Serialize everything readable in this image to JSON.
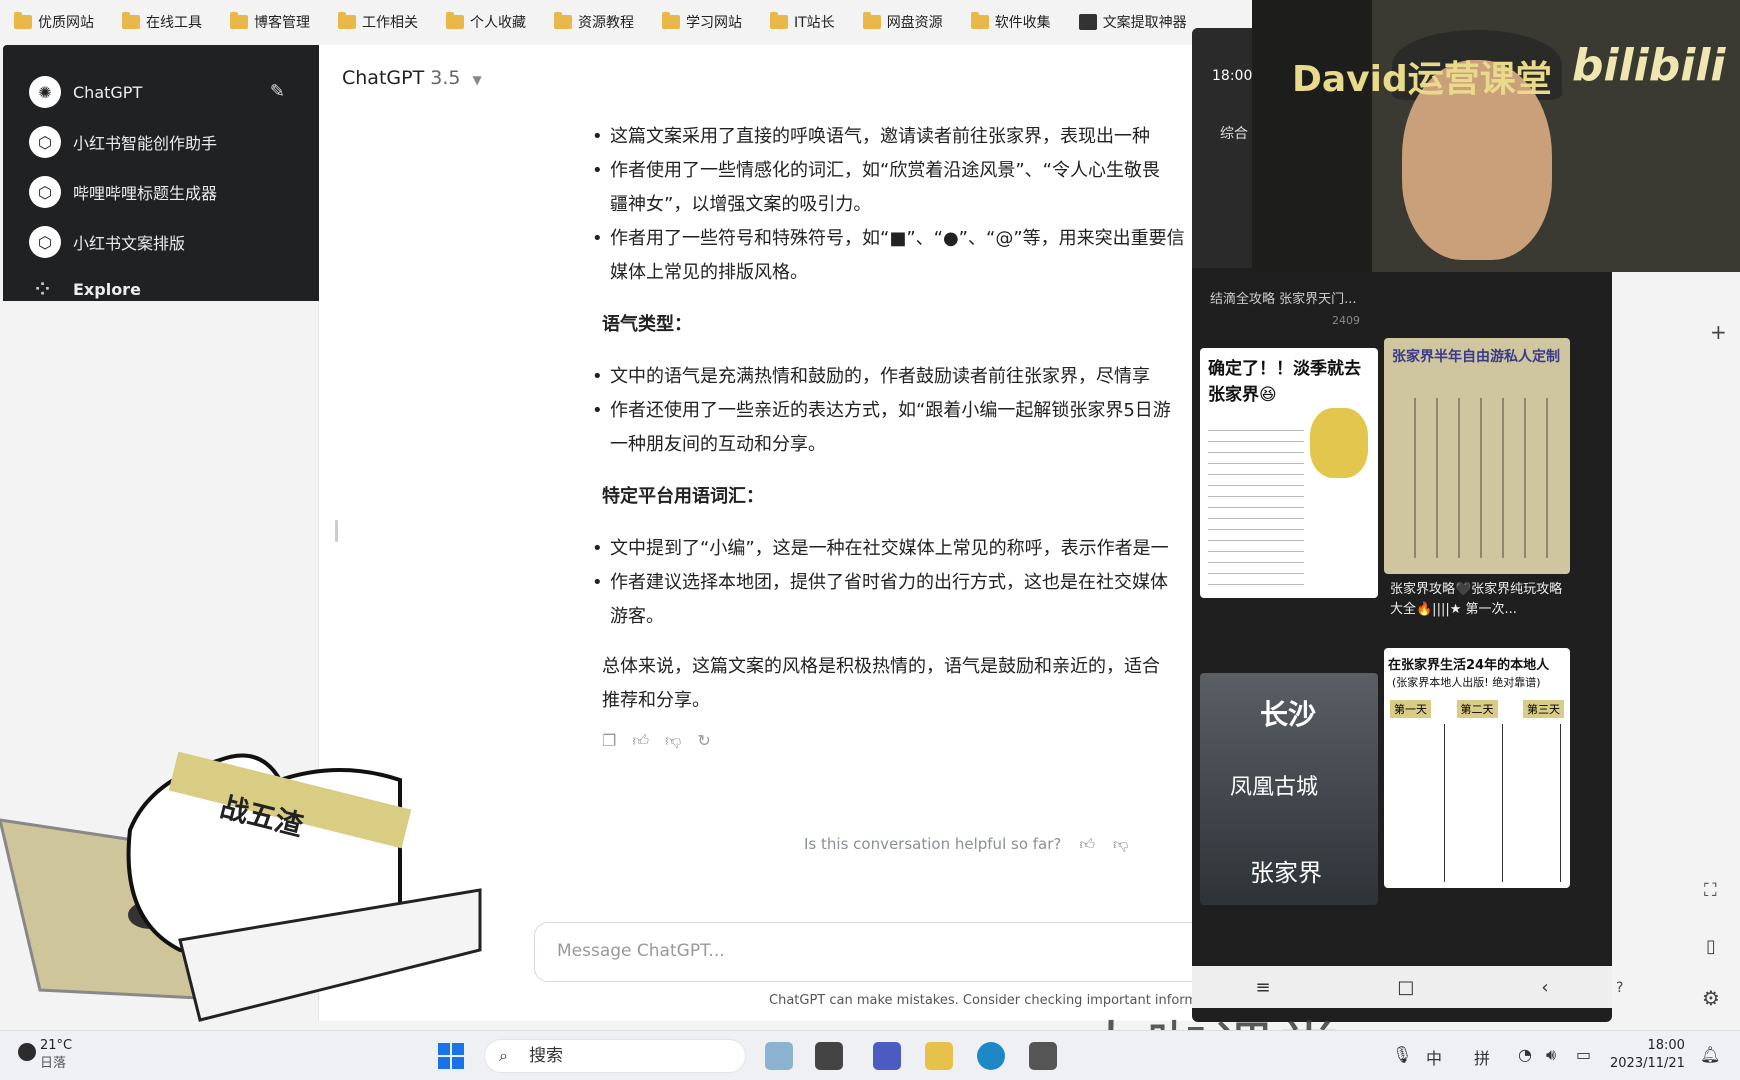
{
  "bookmarks": [
    "优质网站",
    "在线工具",
    "博客管理",
    "工作相关",
    "个人收藏",
    "资源教程",
    "学习网站",
    "IT站长",
    "网盘资源",
    "软件收集",
    "文案提取神器"
  ],
  "sidebar": {
    "items": [
      {
        "label": "ChatGPT",
        "icon": "openai-logo-icon"
      },
      {
        "label": "小红书智能创作助手",
        "icon": "gpt-cube-icon"
      },
      {
        "label": "哔哩哔哩标题生成器",
        "icon": "gpt-cube-icon"
      },
      {
        "label": "小红书文案排版",
        "icon": "gpt-cube-icon"
      }
    ],
    "explore": "Explore"
  },
  "header": {
    "model": "ChatGPT",
    "version": "3.5"
  },
  "content": {
    "b1": "这篇文案采用了直接的呼唤语气，邀请读者前往张家界，表现出一种",
    "b2a": "作者使用了一些情感化的词汇，如“欣赏着沿途风景”、“令人心生敬畏",
    "b2b": "疆神女”，以增强文案的吸引力。",
    "b3a": "作者用了一些符号和特殊符号，如“■”、“●”、“@”等，用来突出重要信",
    "b3b": "媒体上常见的排版风格。",
    "h_tone": "语气类型：",
    "t1": "文中的语气是充满热情和鼓励的，作者鼓励读者前往张家界，尽情享",
    "t2a": "作者还使用了一些亲近的表达方式，如“跟着小编一起解锁张家界5日游",
    "t2b": "一种朋友间的互动和分享。",
    "h_platform": "特定平台用语词汇：",
    "p1": "文中提到了“小编”，这是一种在社交媒体上常见的称呼，表示作者是一",
    "p2a": "作者建议选择本地团，提供了省时省力的出行方式，这也是在社交媒体",
    "p2b": "游客。",
    "sum_a": "总体来说，这篇文案的风格是积极热情的，语气是鼓励和亲近的，适合",
    "sum_b": "推荐和分享。"
  },
  "helpful": "Is this conversation helpful so far?",
  "composer": {
    "placeholder": "Message ChatGPT..."
  },
  "disclaimer": "ChatGPT can make mistakes. Consider checking important inform",
  "phone": {
    "time": "18:00",
    "tab": "综合",
    "card1": "确定了！！淡季就去张家界😆",
    "card2": "张家界半年自由游私人定制",
    "card2_caption": "张家界攻略🖤张家界纯玩攻略大全🔥||||★ 第一次...",
    "card3_top": "长沙",
    "card3_mid": "凤凰古城",
    "card3_bot": "张家界",
    "card4": "在张家界生活24年的本地人",
    "card4_sub": "(张家界本地人出版! 绝对靠谱)",
    "card4_days": [
      "第一天",
      "第二天",
      "第三天"
    ],
    "top_caption": "结滴全攻略 张家界天门...",
    "likes": "2409"
  },
  "webcam": {
    "brand": "David运营课堂",
    "logo": "bilibili"
  },
  "cat": {
    "band_text": "战五渣"
  },
  "taskbar": {
    "temp": "21°C",
    "weather": "日落",
    "search": "搜索",
    "ime1": "中",
    "ime2": "拼",
    "time": "18:00",
    "date": "2023/11/21",
    "watermark": "大咖课堂"
  }
}
